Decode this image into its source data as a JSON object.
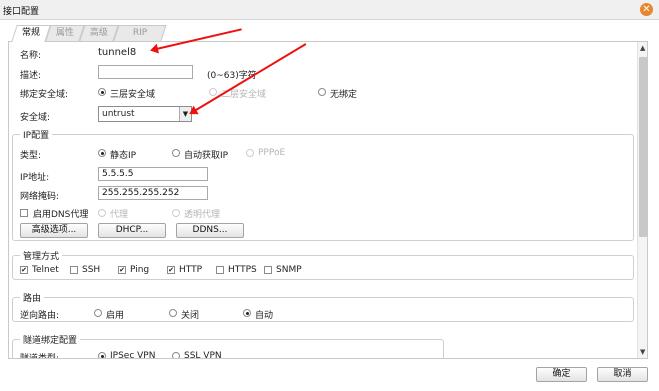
{
  "window": {
    "title": "接口配置",
    "close_glyph": "✕"
  },
  "tabs": [
    {
      "label": "常规"
    },
    {
      "label": "属性"
    },
    {
      "label": "高级"
    },
    {
      "label": "RIP"
    }
  ],
  "form": {
    "name_label": "名称:",
    "name_value": "tunnel8",
    "desc_label": "描述:",
    "desc_value": "",
    "desc_hint": "(0~63)字符",
    "zone_bind_label": "绑定安全域:",
    "zone_bind_options": [
      {
        "label": "三层安全域",
        "selected": true,
        "disabled": false
      },
      {
        "label": "二层安全域",
        "selected": false,
        "disabled": true
      },
      {
        "label": "无绑定",
        "selected": false,
        "disabled": false
      }
    ],
    "zone_label": "安全域:",
    "zone_value": "untrust"
  },
  "ip": {
    "title": "IP配置",
    "type_label": "类型:",
    "type_options": [
      {
        "label": "静态IP",
        "selected": true,
        "disabled": false
      },
      {
        "label": "自动获取IP",
        "selected": false,
        "disabled": false
      },
      {
        "label": "PPPoE",
        "selected": false,
        "disabled": true
      }
    ],
    "ip_label": "IP地址:",
    "ip_value": "5.5.5.5",
    "mask_label": "网络掩码:",
    "mask_value": "255.255.255.252",
    "dns_proxy_label": "启用DNS代理",
    "proxy_label": "代理",
    "transparent_proxy_label": "透明代理",
    "buttons": [
      "高级选项...",
      "DHCP...",
      "DDNS..."
    ]
  },
  "mgmt": {
    "title": "管理方式",
    "items": [
      {
        "label": "Telnet",
        "checked": true
      },
      {
        "label": "SSH",
        "checked": false
      },
      {
        "label": "Ping",
        "checked": true
      },
      {
        "label": "HTTP",
        "checked": true
      },
      {
        "label": "HTTPS",
        "checked": false
      },
      {
        "label": "SNMP",
        "checked": false
      }
    ]
  },
  "routing": {
    "title": "路由",
    "reverse_label": "逆向路由:",
    "options": [
      {
        "label": "启用",
        "selected": false
      },
      {
        "label": "关闭",
        "selected": false
      },
      {
        "label": "自动",
        "selected": true
      }
    ]
  },
  "tunnel": {
    "title": "隧道绑定配置",
    "type_label": "隧道类型:",
    "options": [
      {
        "label": "IPSec VPN",
        "selected": true
      },
      {
        "label": "SSL VPN",
        "selected": false
      }
    ]
  },
  "footer": {
    "ok_label": "确定",
    "cancel_label": "取消"
  },
  "colors": {
    "accent": "#e7862c",
    "annotation_arrow": "#e11111"
  }
}
